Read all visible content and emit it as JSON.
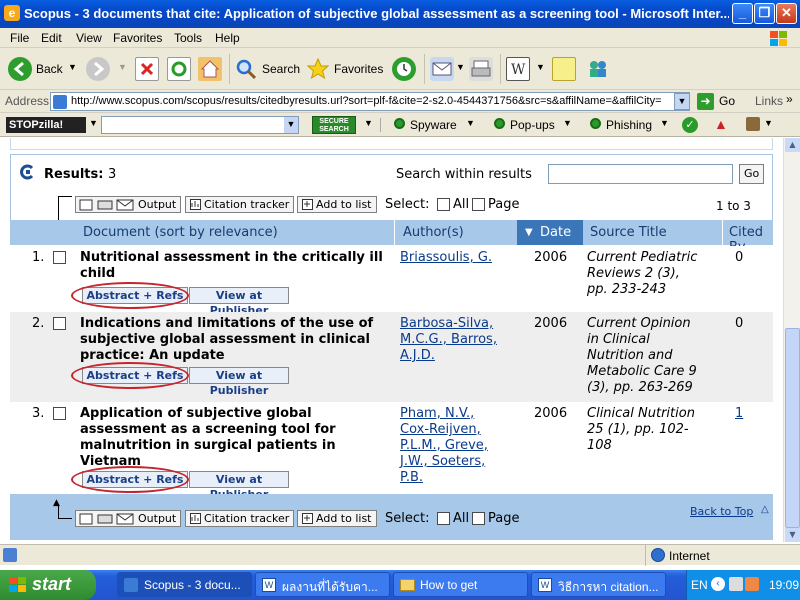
{
  "window": {
    "title": "Scopus - 3 documents that cite: Application of subjective global assessment as a screening tool - Microsoft Inter..."
  },
  "menu": [
    "File",
    "Edit",
    "View",
    "Favorites",
    "Tools",
    "Help"
  ],
  "toolbar": {
    "back": "Back",
    "search": "Search",
    "favorites": "Favorites"
  },
  "address": {
    "label": "Address",
    "url": "http://www.scopus.com/scopus/results/citedbyresults.url?sort=plf-f&cite=2-s2.0-4544371756&src=s&affilName=&affilCity=",
    "go": "Go",
    "links": "Links"
  },
  "stopzilla": {
    "logo": "STOPzilla!",
    "secure_search": "SECURE SEARCH",
    "spyware": "Spyware",
    "popups": "Pop-ups",
    "phishing": "Phishing"
  },
  "results": {
    "label": "Results:",
    "count": "3",
    "search_within_label": "Search within results",
    "search_value": "",
    "go": "Go",
    "output": "Output",
    "citation_tracker": "Citation tracker",
    "add_to_list": "Add to list",
    "select_label": "Select:",
    "all": "All",
    "page": "Page",
    "range": "1 to 3",
    "columns": {
      "document": "Document (sort by relevance)",
      "authors": "Author(s)",
      "date": "Date",
      "source": "Source Title",
      "cited": "Cited By"
    },
    "abstract_btn": "Abstract + Refs",
    "publisher_btn": "View at Publisher",
    "rows": [
      {
        "num": "1.",
        "title": [
          "Nutritional assessment in the critically ill",
          "child"
        ],
        "authors": [
          "Briassoulis, G."
        ],
        "year": "2006",
        "source": [
          "Current Pediatric",
          "Reviews 2 (3),",
          "pp. 233-243"
        ],
        "cited": "0"
      },
      {
        "num": "2.",
        "title": [
          "Indications and limitations of the use of",
          "subjective global assessment in clinical",
          "practice: An update"
        ],
        "authors": [
          "Barbosa-Silva,",
          "M.C.G., Barros,",
          "A.J.D."
        ],
        "year": "2006",
        "source": [
          "Current Opinion",
          "in Clinical",
          "Nutrition and",
          "Metabolic Care 9",
          "(3), pp. 263-269"
        ],
        "cited": "0"
      },
      {
        "num": "3.",
        "title": [
          "Application of subjective global",
          "assessment as a screening tool for",
          "malnutrition in surgical patients in",
          "Vietnam"
        ],
        "authors": [
          "Pham, N.V.,",
          "Cox-Reijven,",
          "P.L.M., Greve,",
          "J.W., Soeters,",
          "P.B."
        ],
        "year": "2006",
        "source": [
          "Clinical Nutrition",
          "25 (1), pp. 102-",
          "108"
        ],
        "cited": "1"
      }
    ],
    "back_to_top": "Back to Top"
  },
  "status": {
    "zone": "Internet"
  },
  "taskbar": {
    "start": "start",
    "tasks": [
      "Scopus - 3 docu...",
      "ผลงานที่ได้รับคา...",
      "How to get",
      "วิธีการหา citation..."
    ],
    "lang": "EN",
    "clock": "19:09"
  }
}
